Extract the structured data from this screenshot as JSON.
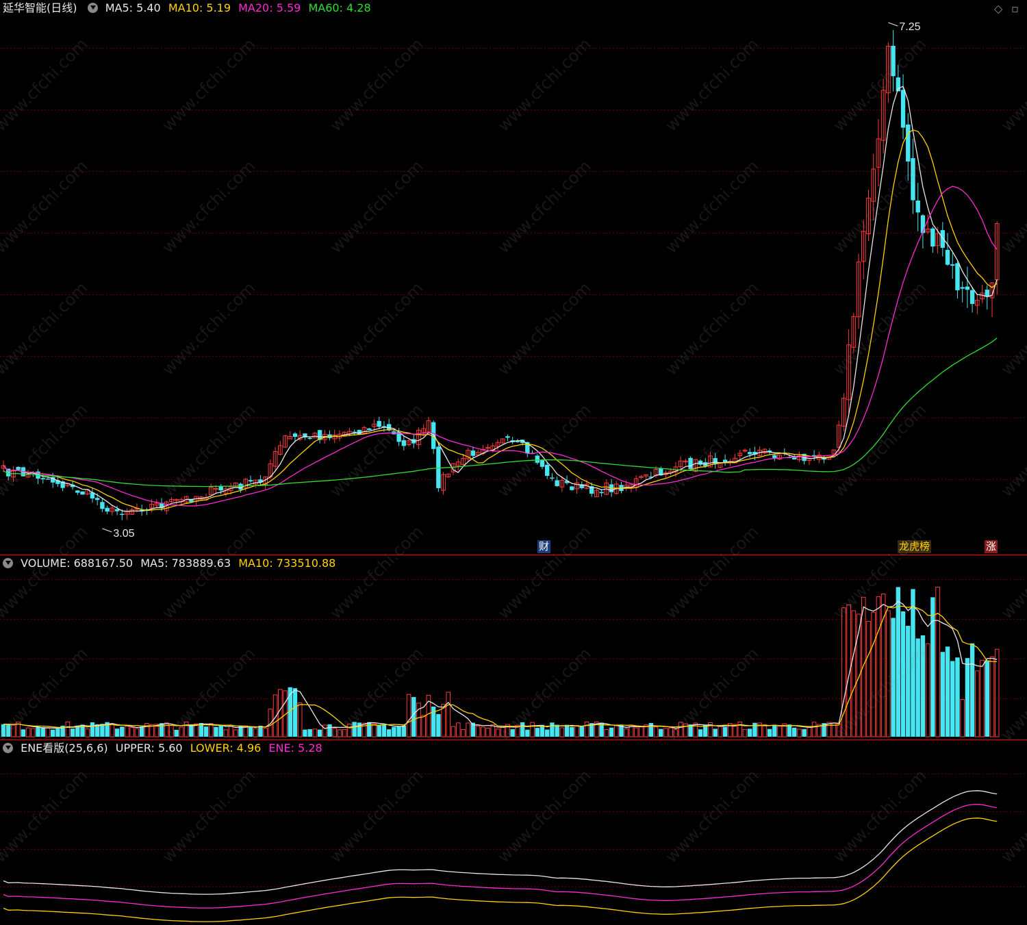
{
  "header": {
    "title": "延华智能(日线)",
    "ma": [
      {
        "label": "MA5: 5.40",
        "color": "#e8e8e8"
      },
      {
        "label": "MA10: 5.19",
        "color": "#ffd200"
      },
      {
        "label": "MA20: 5.59",
        "color": "#ff2ad4"
      },
      {
        "label": "MA60: 4.28",
        "color": "#2ee02e"
      }
    ]
  },
  "volume_header": {
    "items": [
      {
        "label": "VOLUME: 688167.50",
        "color": "#e8e8e8"
      },
      {
        "label": "MA5: 783889.63",
        "color": "#e8e8e8"
      },
      {
        "label": "MA10: 733510.88",
        "color": "#ffd200"
      }
    ]
  },
  "ene_header": {
    "items": [
      {
        "label": "ENE看版(25,6,6)",
        "color": "#e8e8e8"
      },
      {
        "label": "UPPER: 5.60",
        "color": "#e8e8e8"
      },
      {
        "label": "LOWER: 4.96",
        "color": "#ffd200"
      },
      {
        "label": "ENE: 5.28",
        "color": "#ff2ad4"
      }
    ]
  },
  "corner_icons": [
    "diamond-icon",
    "restore-icon"
  ],
  "corner_glyphs": {
    "diamond": "◇",
    "restore": "▫"
  },
  "markers": [
    {
      "text": "财",
      "color": "#ffffff",
      "bg": "#1d3c7a"
    },
    {
      "text": "龙虎榜",
      "color": "#ffd200",
      "bg": "#3a2a10"
    },
    {
      "text": "涨",
      "color": "#ffffff",
      "bg": "#8a1a1a"
    }
  ],
  "watermark": "www.cfchi.com",
  "chart_data": {
    "type": "candlestick",
    "price_annotations": {
      "high": "7.25",
      "low": "3.05"
    },
    "high_value": 7.25,
    "low_value": 3.05,
    "colors": {
      "up": "#ff3b3b",
      "down": "#45e6f2",
      "ma5": "#e8e8e8",
      "ma10": "#ffd200",
      "ma20": "#ff2ad4",
      "ma60": "#2ee02e",
      "grid": "#5a0000",
      "divider": "#b01010"
    }
  }
}
